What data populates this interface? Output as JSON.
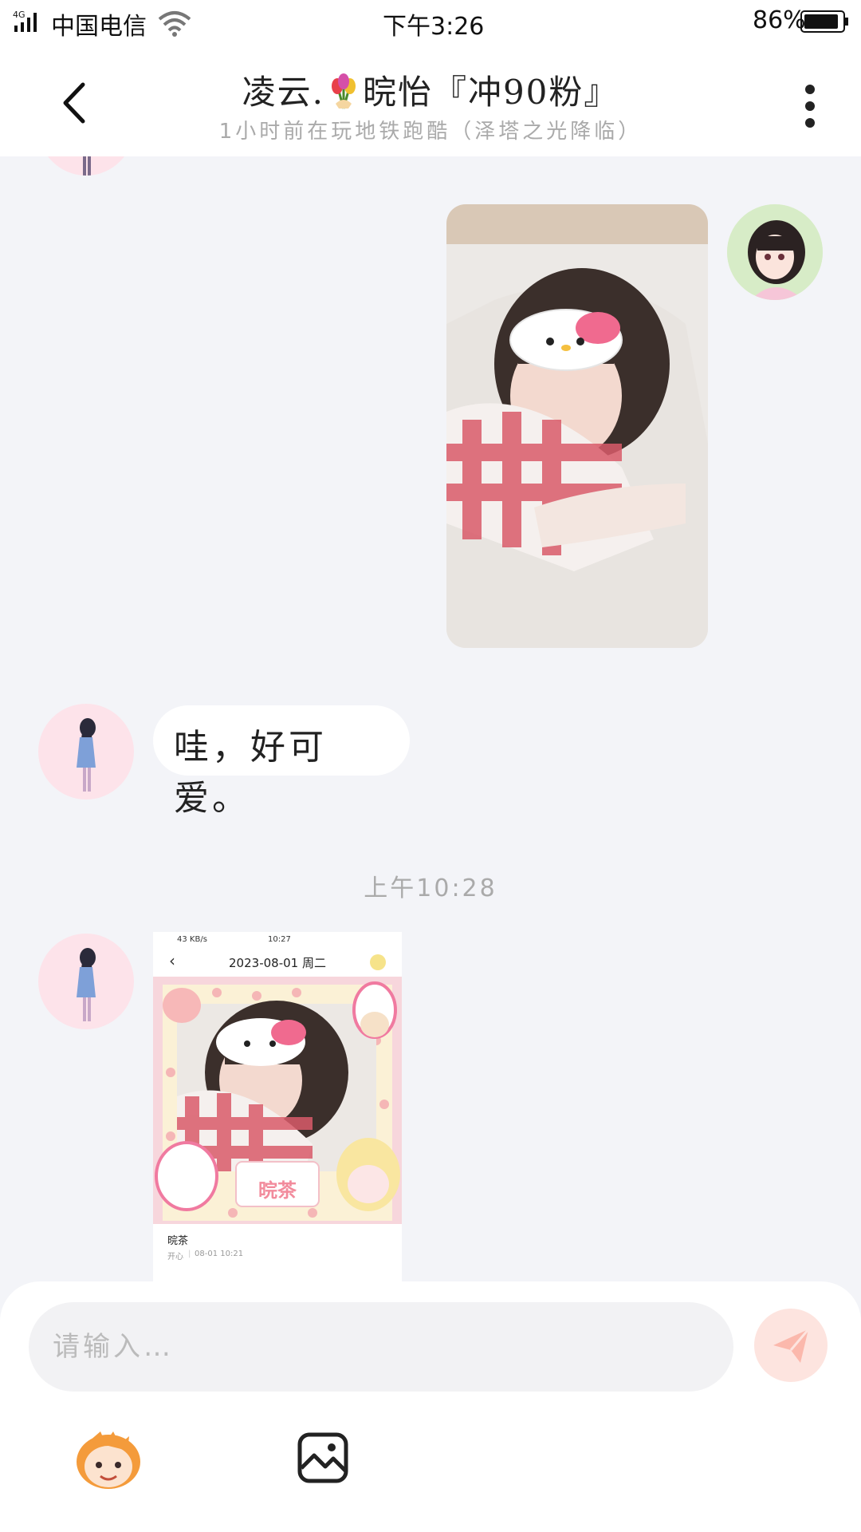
{
  "status_bar": {
    "network": "4G",
    "carrier": "中国电信",
    "time": "下午3:26",
    "battery": "86%"
  },
  "header": {
    "title_prefix": "凌云.",
    "title_main": "晥怡『冲90粉』",
    "subtitle": "1小时前在玩地铁跑酷（泽塔之光降临）"
  },
  "messages": [
    {
      "type": "image",
      "side": "right",
      "name": "photo-girl-hellokitty"
    },
    {
      "type": "text",
      "side": "left",
      "text": "哇，好可爱。"
    },
    {
      "type": "timestamp",
      "text": "上午10:28"
    },
    {
      "type": "screenshot",
      "side": "left"
    }
  ],
  "shared_card": {
    "status_speed": "43 KB/s",
    "status_time": "10:27",
    "date_title": "2023-08-01 周二",
    "sticker_text": "晥茶",
    "card_name": "晥茶",
    "card_mood": "开心",
    "card_time": "08-01 10:21"
  },
  "composer": {
    "placeholder": "请输入…"
  },
  "colors": {
    "background": "#f3f4f8",
    "send_button": "#fde4df",
    "avatar_bg": "#fde3ea"
  }
}
